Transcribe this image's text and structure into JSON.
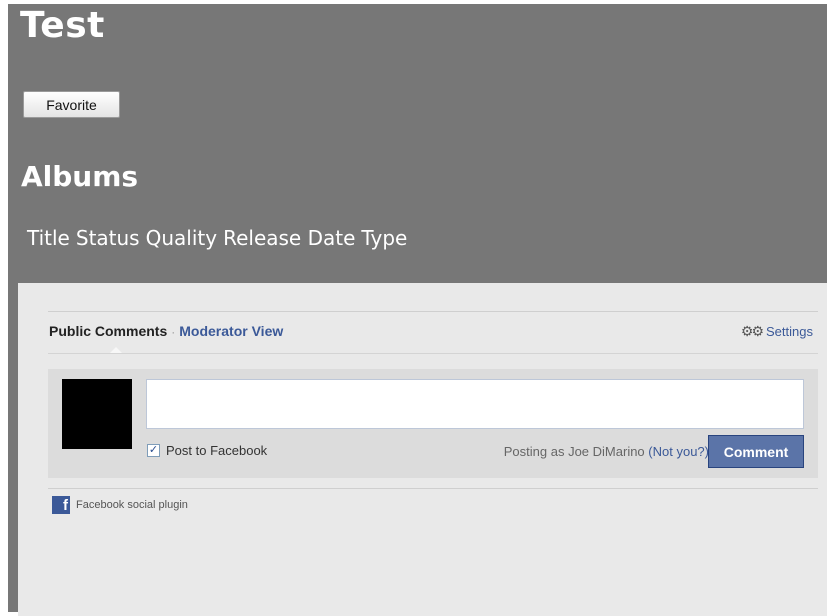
{
  "page": {
    "title": "Test",
    "favorite_label": "Favorite",
    "albums_heading": "Albums",
    "album_columns": [
      "Title",
      "Status",
      "Quality",
      "Release Date",
      "Type"
    ]
  },
  "facebook": {
    "tab_public": "Public Comments",
    "separator": "·",
    "tab_moderator": "Moderator View",
    "settings_label": "Settings",
    "post_to_label": "Post to Facebook",
    "post_to_checked": true,
    "posting_as": "Posting as Joe DiMarino",
    "not_you": "(Not you?)",
    "comment_label": "Comment",
    "plugin_label": "Facebook social plugin",
    "textarea_value": "",
    "textarea_placeholder": ""
  },
  "colors": {
    "frame_bg": "#777777",
    "panel_bg": "#e9e9e9",
    "facebook_blue": "#3b5998",
    "comment_button": "#5b74a8"
  }
}
